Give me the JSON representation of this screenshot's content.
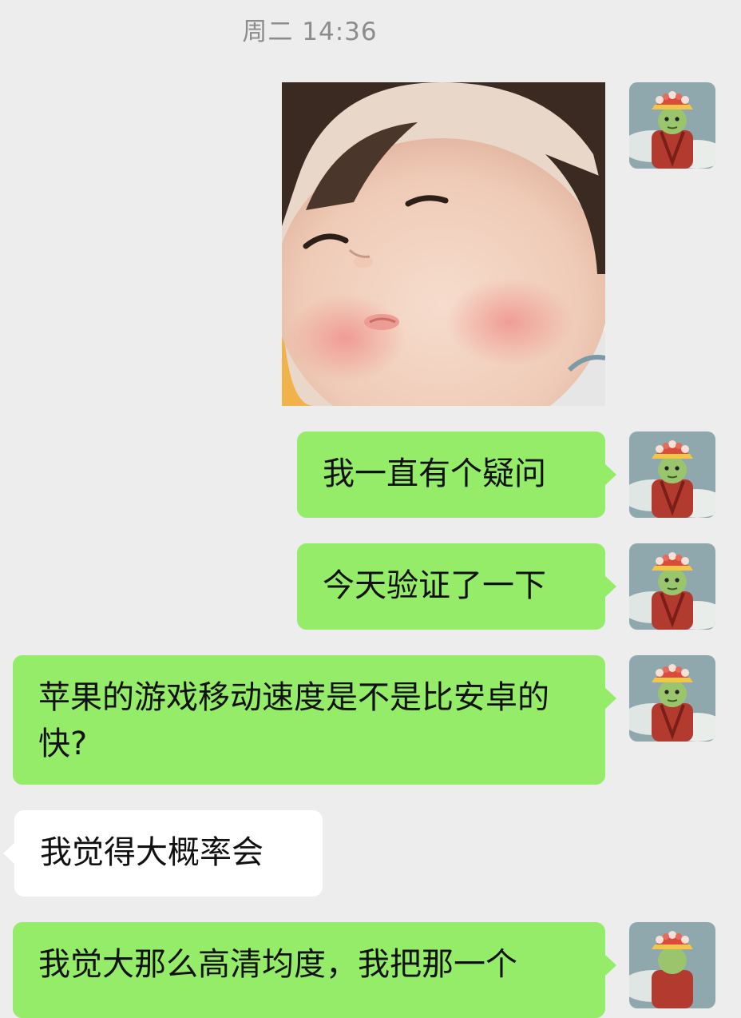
{
  "chat": {
    "timestamp": "周二 14:36",
    "messages": [
      {
        "side": "out",
        "type": "image",
        "avatar": "self-avatar"
      },
      {
        "side": "out",
        "type": "text",
        "text": "我一直有个疑问"
      },
      {
        "side": "out",
        "type": "text",
        "text": "今天验证了一下"
      },
      {
        "side": "out",
        "type": "text",
        "text": "苹果的游戏移动速度是不是比安卓的快?"
      },
      {
        "side": "in",
        "type": "text",
        "text": "我觉得大概率会"
      },
      {
        "side": "out",
        "type": "text",
        "text": "我觉大那么高清均度，我把那一个"
      }
    ]
  },
  "colors": {
    "background": "#ededed",
    "outgoing_bubble": "#95ec69",
    "incoming_bubble": "#ffffff",
    "timestamp_text": "#8c8c8c"
  }
}
